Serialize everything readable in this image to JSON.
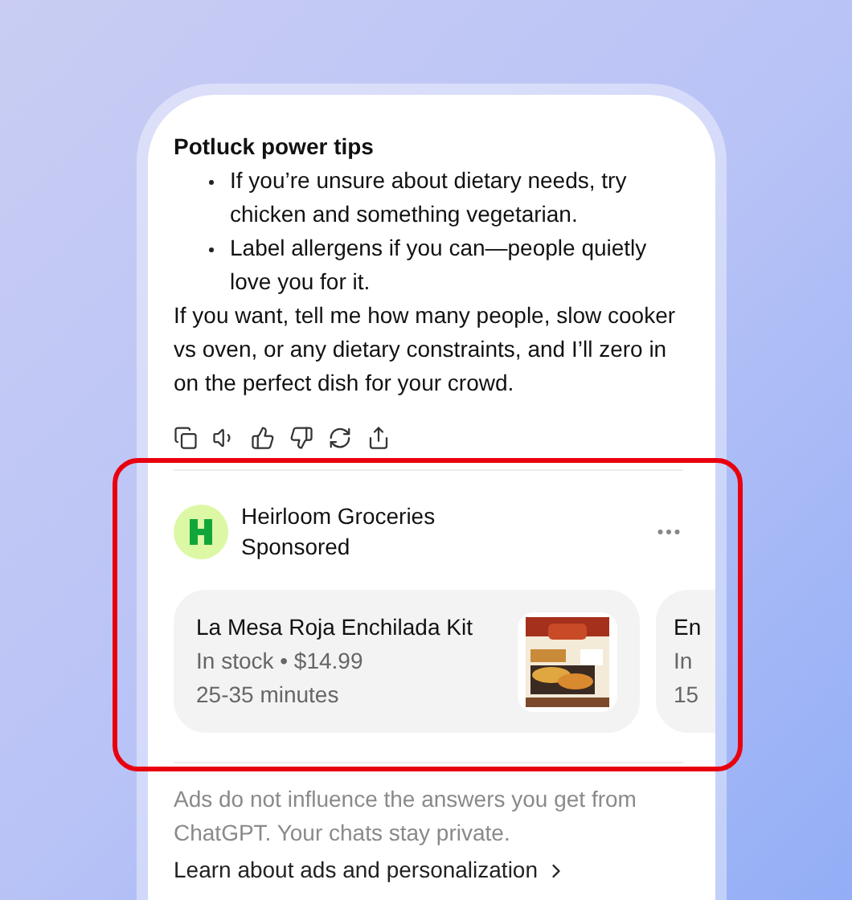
{
  "message": {
    "heading": "Potluck power tips",
    "bullets": [
      "If you’re unsure about dietary needs, try chicken and something vegetarian.",
      "Label allergens if you can—people quietly love you for it."
    ],
    "paragraph": "If you want, tell me how many people, slow cooker vs oven, or any dietary constraints, and I’ll zero in on the perfect dish for your crowd."
  },
  "ad": {
    "highlighted": true,
    "advertiser": "Heirloom Groceries",
    "label": "Sponsored",
    "products": [
      {
        "name": "La Mesa Roja Enchilada Kit",
        "details": [
          "In stock • $14.99",
          "25-35 minutes"
        ]
      },
      {
        "name": "En",
        "details": [
          "In",
          "15"
        ]
      }
    ]
  },
  "disclaimer": "Ads do not influence the answers you get from ChatGPT. Your chats stay private.",
  "link": "Learn about ads and personalization"
}
